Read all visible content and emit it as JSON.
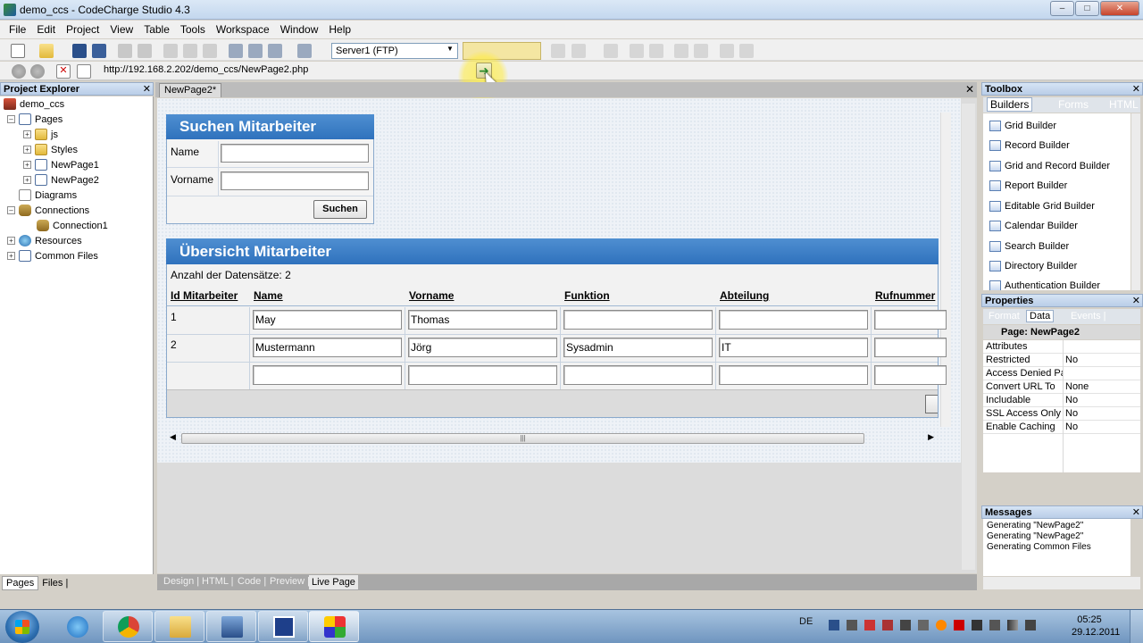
{
  "window": {
    "title": "demo_ccs - CodeCharge Studio 4.3"
  },
  "menu": [
    "File",
    "Edit",
    "Project",
    "View",
    "Table",
    "Tools",
    "Workspace",
    "Window",
    "Help"
  ],
  "toolbar": {
    "server": "Server1 (FTP)"
  },
  "address": {
    "url": "http://192.168.2.202/demo_ccs/NewPage2.php"
  },
  "project_explorer": {
    "title": "Project Explorer",
    "items": [
      {
        "label": "demo_ccs"
      },
      {
        "label": "Pages"
      },
      {
        "label": "js"
      },
      {
        "label": "Styles"
      },
      {
        "label": "NewPage1"
      },
      {
        "label": "NewPage2"
      },
      {
        "label": "Diagrams"
      },
      {
        "label": "Connections"
      },
      {
        "label": "Connection1"
      },
      {
        "label": "Resources"
      },
      {
        "label": "Common Files"
      }
    ],
    "tabs": [
      "Pages",
      "Files |"
    ]
  },
  "document": {
    "tab": "NewPage2*",
    "search_form": {
      "title": "Suchen Mitarbeiter",
      "name_label": "Name",
      "vorname_label": "Vorname",
      "button": "Suchen"
    },
    "grid": {
      "title": "Übersicht Mitarbeiter",
      "count": "Anzahl der Datensätze: 2",
      "columns": [
        "Id Mitarbeiter",
        "Name",
        "Vorname",
        "Funktion",
        "Abteilung",
        "Rufnummer"
      ],
      "rows": [
        {
          "id": "1",
          "name": "May",
          "vorname": "Thomas",
          "funktion": "",
          "abteilung": ""
        },
        {
          "id": "2",
          "name": "Mustermann",
          "vorname": "Jörg",
          "funktion": "Sysadmin",
          "abteilung": "IT"
        }
      ]
    },
    "view_tabs": [
      "Design |",
      "HTML |",
      "Code |",
      "Preview |",
      "Live Page"
    ]
  },
  "toolbox": {
    "title": "Toolbox",
    "tabs": [
      "Builders",
      "Forms",
      "HTML"
    ],
    "items": [
      "Grid Builder",
      "Record Builder",
      "Grid and Record Builder",
      "Report Builder",
      "Editable Grid Builder",
      "Calendar Builder",
      "Search Builder",
      "Directory Builder",
      "Authentication Builder"
    ]
  },
  "properties": {
    "title": "Properties",
    "tabs": [
      "Format",
      "Data",
      "Events |"
    ],
    "object": "Page: NewPage2",
    "rows": [
      {
        "key": "Attributes",
        "value": ""
      },
      {
        "key": "Restricted",
        "value": "No"
      },
      {
        "key": "Access Denied Pa",
        "value": ""
      },
      {
        "key": "Convert URL To",
        "value": "None"
      },
      {
        "key": "Includable",
        "value": "No"
      },
      {
        "key": "SSL Access Only",
        "value": "No"
      },
      {
        "key": "Enable Caching",
        "value": "No"
      }
    ]
  },
  "messages": {
    "title": "Messages",
    "lines": [
      "Generating \"NewPage2\"",
      "Generating \"NewPage2\"",
      "Generating Common Files"
    ]
  },
  "taskbar": {
    "lang": "DE",
    "time": "05:25",
    "date": "29.12.2011"
  },
  "colors": {
    "accent_blue": "#2f72bd",
    "highlight_yellow": "#f4e6a2"
  }
}
